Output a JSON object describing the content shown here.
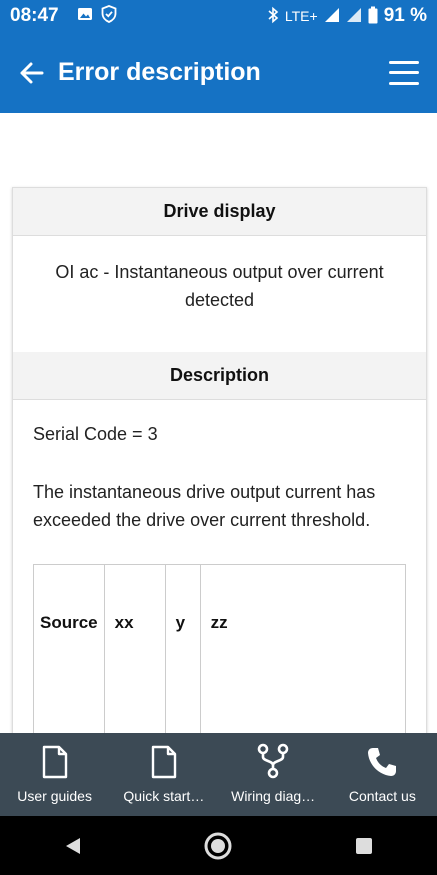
{
  "status_bar": {
    "time": "08:47",
    "network": "LTE+",
    "battery": "91 %"
  },
  "app_bar": {
    "title": "Error description"
  },
  "drive_display": {
    "header": "Drive display",
    "text": "OI ac - Instantaneous output over current detected"
  },
  "description": {
    "header": "Description",
    "serial_code": "Serial Code = 3",
    "summary": "The instantaneous drive output current has exceeded the drive over current threshold.",
    "table": {
      "columns": [
        "Source",
        "xx",
        "y",
        "zz"
      ]
    }
  },
  "bottom_nav": {
    "items": [
      {
        "label": "User guides",
        "icon": "document-icon"
      },
      {
        "label": "Quick start…",
        "icon": "document-icon"
      },
      {
        "label": "Wiring diag…",
        "icon": "wiring-icon"
      },
      {
        "label": "Contact us",
        "icon": "phone-icon"
      }
    ]
  },
  "colors": {
    "primary": "#1572c4",
    "bottom_nav_bg": "#3c4a55",
    "header_bg": "#f3f3f3"
  }
}
